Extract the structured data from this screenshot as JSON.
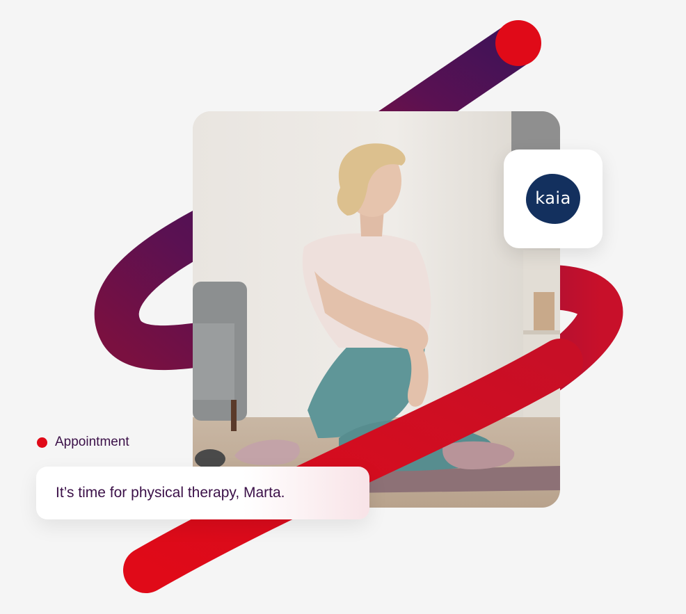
{
  "logo": {
    "text": "kaia",
    "background": "#13305e"
  },
  "notification": {
    "label": "Appointment",
    "message": "It’s time for physical therapy, Marta."
  },
  "colors": {
    "accent_red": "#e00a18",
    "ribbon_purple": "#4a1156",
    "text_purple": "#3b1048",
    "background": "#f5f5f5"
  }
}
